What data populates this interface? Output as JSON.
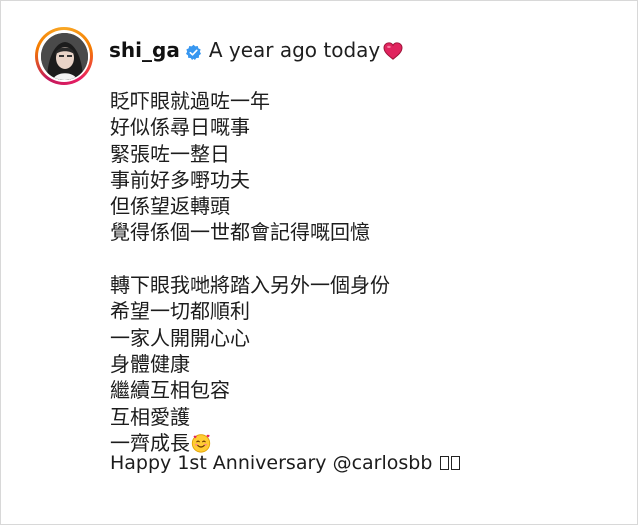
{
  "post": {
    "username": "shi_ga",
    "header_text": "A year ago today",
    "icons": {
      "verified": "verified-badge-icon",
      "heart": "red-heart-icon",
      "emoji": "smiling-face-with-hearts-icon",
      "missing_glyph": "missing-glyph-box-icon"
    },
    "colors": {
      "verified_badge": "#3897f0",
      "heart": "#e0245e"
    },
    "caption_lines_1": [
      "眨吓眼就過咗一年",
      "好似係尋日嘅事",
      "緊張咗一整日",
      "事前好多嘢功夫",
      "但係望返轉頭",
      "覺得係個一世都會記得嘅回憶"
    ],
    "caption_lines_2": [
      "轉下眼我哋將踏入另外一個身份",
      "希望一切都順利",
      "一家人開開心心",
      "身體健康",
      "繼續互相包容",
      "互相愛護",
      "一齊成長"
    ],
    "footer": {
      "text": "Happy 1st Anniversary ",
      "mention": "@carlosbb"
    }
  }
}
